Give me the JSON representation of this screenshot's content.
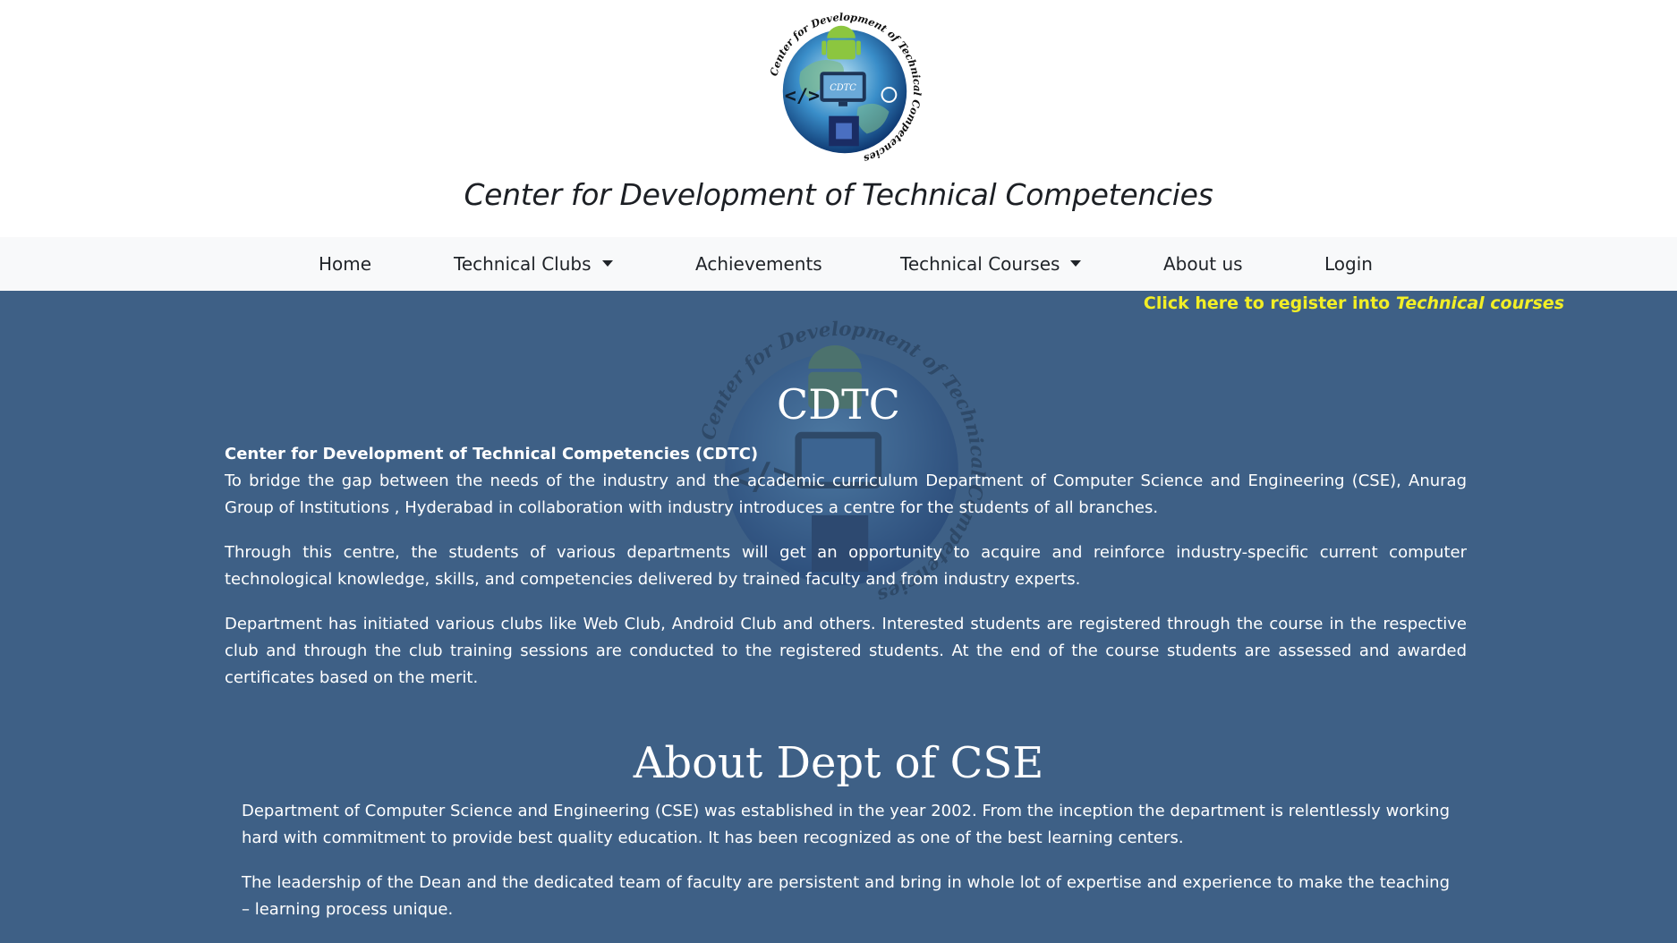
{
  "header": {
    "title": "Center for Development of Technical Competencies",
    "logo": {
      "ring_text": "Center for Development of Technical Competencies",
      "screen_text": "CDTC"
    }
  },
  "nav": {
    "items": [
      {
        "label": "Home",
        "dropdown": false
      },
      {
        "label": "Technical Clubs",
        "dropdown": true
      },
      {
        "label": "Achievements",
        "dropdown": false
      },
      {
        "label": "Technical Courses",
        "dropdown": true
      },
      {
        "label": "About us",
        "dropdown": false
      },
      {
        "label": "Login",
        "dropdown": false
      }
    ]
  },
  "register": {
    "prefix": "Click here to register into ",
    "emphasis": "Technical courses"
  },
  "cdtc": {
    "heading": "CDTC",
    "lead": "Center for Development of Technical Competencies (CDTC)",
    "paragraphs": [
      "To bridge the gap between the needs of the industry and the academic curriculum Department of Computer Science and Engineering (CSE), Anurag Group of Institutions , Hyderabad in collaboration with industry introduces a centre for the students of all branches.",
      "Through this centre, the students of various departments will get an opportunity to acquire and reinforce industry-specific current computer technological knowledge, skills, and competencies delivered by trained faculty and from industry experts.",
      "Department has initiated various clubs like Web Club, Android Club and others. Interested students are registered through the course in the respective club and through the club training sessions are conducted to the registered students. At the end of the course students are assessed and awarded certificates based on the merit."
    ]
  },
  "about_cse": {
    "heading": "About Dept of CSE",
    "paragraphs": [
      "Department of Computer Science and Engineering (CSE) was established in the year 2002. From the inception the department is relentlessly working hard with commitment to provide best quality education. It has been recognized as one of the best learning centers.",
      "The leadership of the Dean and the dedicated team of faculty are persistent and bring in whole lot of expertise and experience to make the teaching – learning process unique."
    ]
  },
  "colors": {
    "main_background": "#3e6086",
    "register_link": "#f2ee26",
    "nav_background": "#f8f9fa"
  }
}
